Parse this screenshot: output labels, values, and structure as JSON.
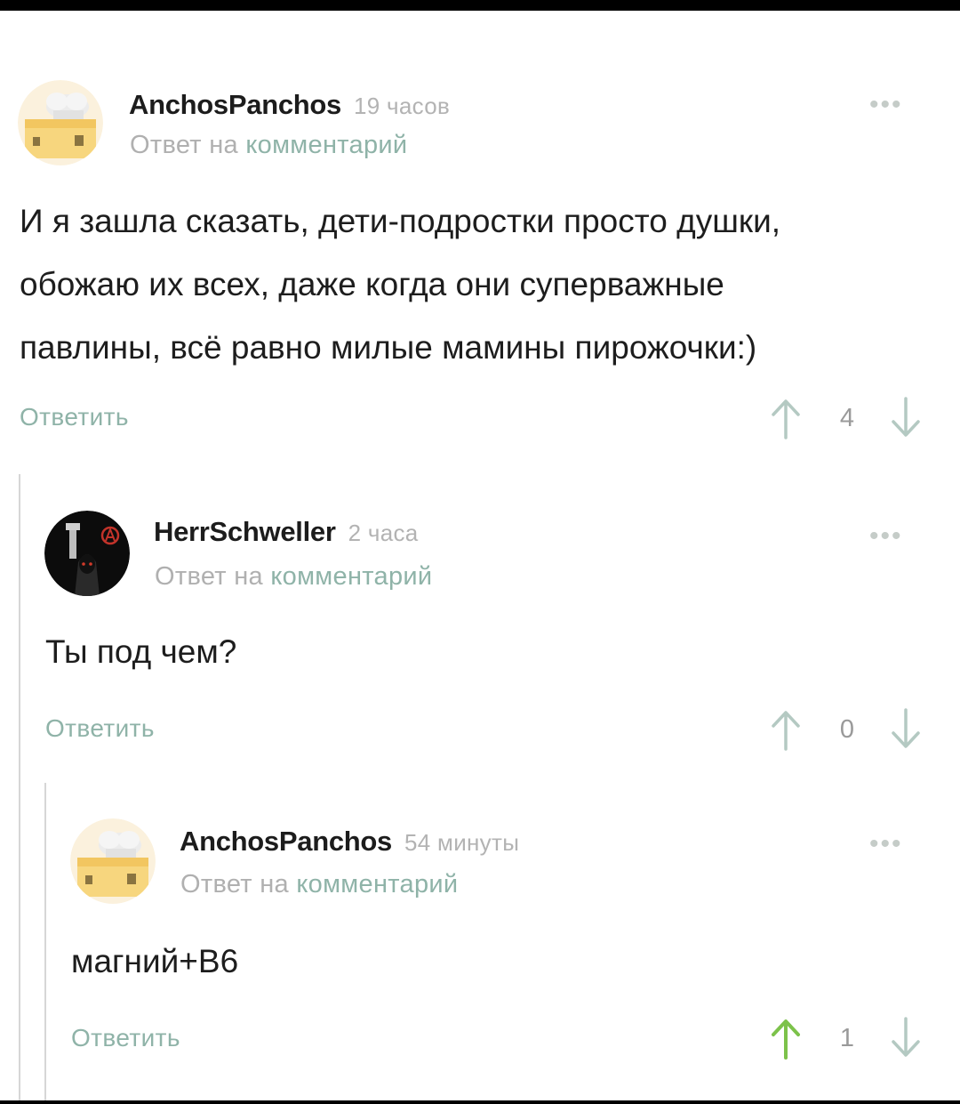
{
  "comments": [
    {
      "author": "AnchosPanchos",
      "time": "19 часов",
      "reply_prefix": "Ответ на",
      "reply_link": "комментарий",
      "more": "•••",
      "body_lines": [
        "И я зашла сказать, дети-подростки просто душки,",
        "обожаю их всех, даже когда они суперважные",
        "павлины, всё равно милые мамины пирожочки:)"
      ],
      "reply_label": "Ответить",
      "votes": "4",
      "avatar_icon": "chef-toaster-avatar-icon"
    },
    {
      "author": "HerrSchweller",
      "time": "2 часа",
      "reply_prefix": "Ответ на",
      "reply_link": "комментарий",
      "more": "•••",
      "body_lines": [
        "Ты под чем?"
      ],
      "reply_label": "Ответить",
      "votes": "0",
      "avatar_icon": "hooded-figure-avatar-icon"
    },
    {
      "author": "AnchosPanchos",
      "time": "54 минуты",
      "reply_prefix": "Ответ на",
      "reply_link": "комментарий",
      "more": "•••",
      "body_lines": [
        "магний+В6"
      ],
      "reply_label": "Ответить",
      "votes": "1",
      "avatar_icon": "chef-toaster-avatar-icon"
    }
  ],
  "colors": {
    "link_green": "#8fb3a8",
    "upvoted_green": "#7cc24a",
    "muted_gray": "#b3b3b3"
  }
}
